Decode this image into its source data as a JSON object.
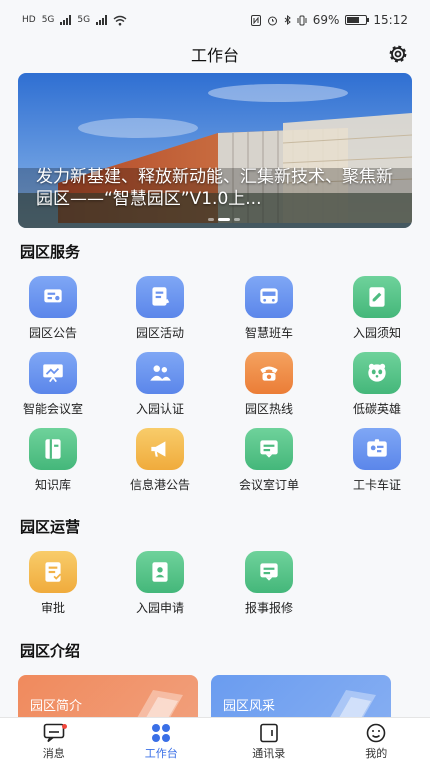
{
  "status_bar": {
    "left": [
      "HD",
      "5G",
      "5G"
    ],
    "battery": "69%",
    "time": "15:12",
    "battery_level": 0.69
  },
  "header": {
    "title": "工作台"
  },
  "banner": {
    "caption": "发力新基建、释放新动能、汇集新技术、聚焦新园区——“智慧园区”V1.0上...",
    "slides": 3,
    "active_slide": 1
  },
  "sections": {
    "services_title": "园区服务",
    "operations_title": "园区运营",
    "intro_title": "园区介绍"
  },
  "services": [
    {
      "label": "园区公告",
      "color": "blue",
      "icon": "announcement-icon"
    },
    {
      "label": "园区活动",
      "color": "blue",
      "icon": "activity-icon"
    },
    {
      "label": "智慧班车",
      "color": "blue",
      "icon": "bus-icon"
    },
    {
      "label": "入园须知",
      "color": "green",
      "icon": "notice-icon"
    },
    {
      "label": "智能会议室",
      "color": "blue",
      "icon": "meeting-room-icon"
    },
    {
      "label": "入园认证",
      "color": "blue",
      "icon": "users-icon"
    },
    {
      "label": "园区热线",
      "color": "orange",
      "icon": "phone-icon"
    },
    {
      "label": "低碳英雄",
      "color": "green",
      "icon": "panda-icon"
    },
    {
      "label": "知识库",
      "color": "green",
      "icon": "book-icon"
    },
    {
      "label": "信息港公告",
      "color": "yellow",
      "icon": "megaphone-icon"
    },
    {
      "label": "会议室订单",
      "color": "green",
      "icon": "order-icon"
    },
    {
      "label": "工卡车证",
      "color": "blue",
      "icon": "id-card-icon"
    }
  ],
  "operations": [
    {
      "label": "审批",
      "color": "yellow",
      "icon": "approval-icon"
    },
    {
      "label": "入园申请",
      "color": "green",
      "icon": "application-icon"
    },
    {
      "label": "报事报修",
      "color": "green",
      "icon": "repair-icon"
    }
  ],
  "intro_cards": [
    {
      "label": "园区简介",
      "color": "#f08a5d"
    },
    {
      "label": "园区风采",
      "color": "#6a9cf0"
    }
  ],
  "bottom_nav": [
    {
      "label": "消息",
      "icon": "message-icon",
      "badge": true
    },
    {
      "label": "工作台",
      "icon": "workbench-icon",
      "active": true
    },
    {
      "label": "通讯录",
      "icon": "contacts-icon"
    },
    {
      "label": "我的",
      "icon": "profile-icon"
    }
  ]
}
